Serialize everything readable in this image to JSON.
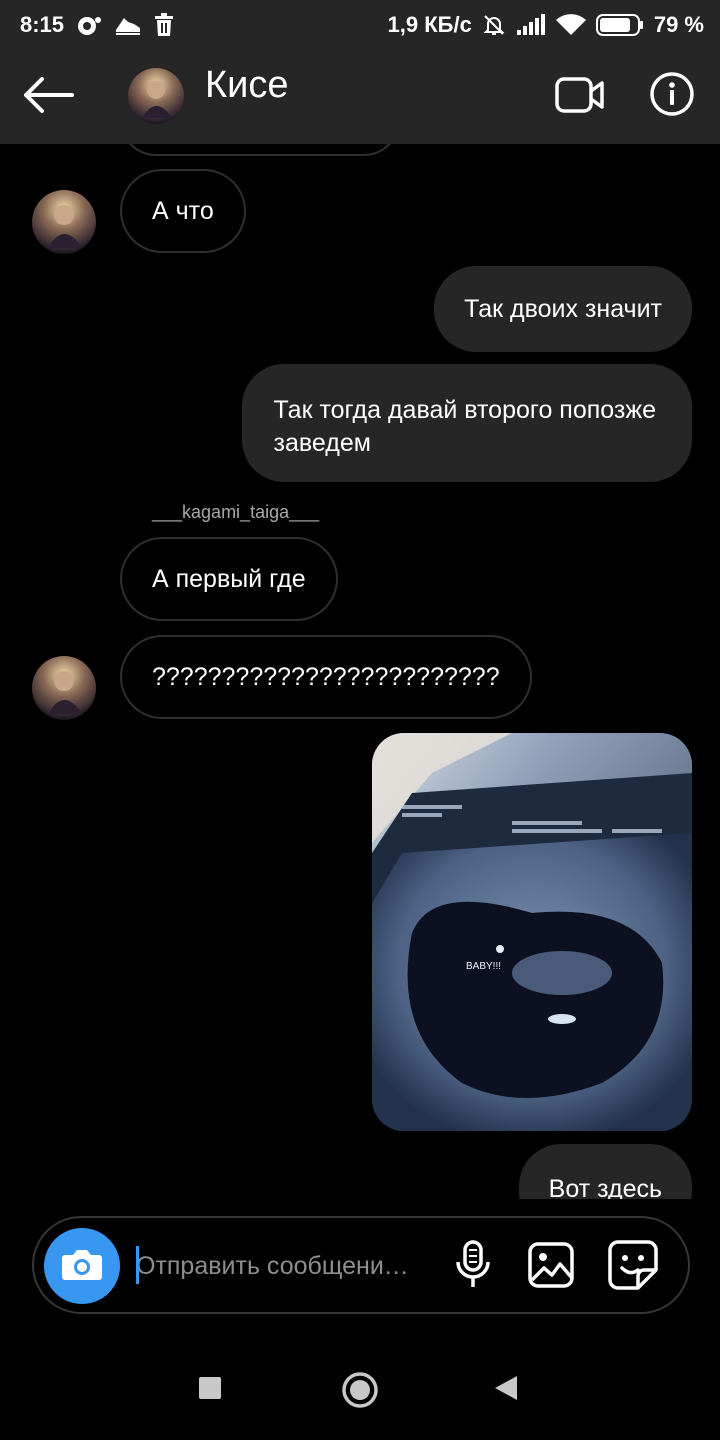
{
  "status_bar": {
    "time": "8:15",
    "network_speed": "1,9 КБ/с",
    "battery": "79 %",
    "icons": [
      "camera-notification-icon",
      "shoe-notification-icon",
      "trash-notification-icon",
      "mute-icon",
      "signal-icon",
      "wifi-icon",
      "battery-icon"
    ]
  },
  "header": {
    "title": "Кисе",
    "icons": [
      "back-arrow-icon",
      "avatar",
      "video-call-icon",
      "info-icon"
    ]
  },
  "messages": [
    {
      "direction": "in",
      "text": "А что"
    },
    {
      "direction": "out",
      "text": "Так двоих значит"
    },
    {
      "direction": "out",
      "text_lines": [
        "Так тогда давай второго попозже",
        "заведем"
      ]
    },
    {
      "direction": "in",
      "sender": "___kagami_taiga___",
      "text": "А первый где"
    },
    {
      "direction": "in",
      "text": "?????????????????????????"
    },
    {
      "direction": "out",
      "type": "photo",
      "photo_text": "BABY!!!"
    },
    {
      "direction": "out",
      "text": "Вот здесь"
    }
  ],
  "composer": {
    "placeholder": "Отправить сообщени…",
    "icons": [
      "camera-icon",
      "microphone-icon",
      "gallery-icon",
      "sticker-icon"
    ]
  },
  "nav_bar": {
    "icons": [
      "recents-square-icon",
      "home-circle-icon",
      "back-triangle-icon"
    ]
  },
  "colors": {
    "bar_background": "#262626",
    "background": "#000000",
    "outgoing_bubble": "#262626",
    "incoming_border": "#2f2f2f",
    "accent_blue": "#3897f0"
  }
}
